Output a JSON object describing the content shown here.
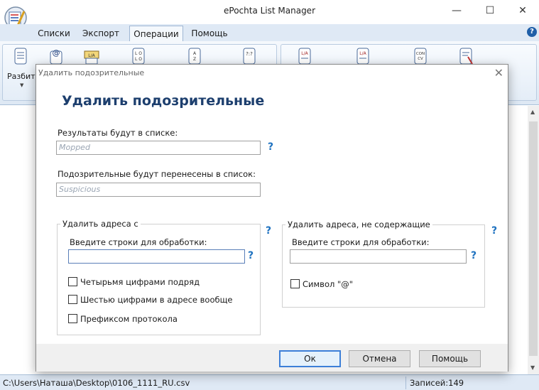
{
  "window": {
    "title": "ePochta List Manager",
    "controls": {
      "minimize": "—",
      "maximize": "☐",
      "close": "✕"
    }
  },
  "menu": {
    "tabs": [
      {
        "label": "Списки",
        "active": false
      },
      {
        "label": "Экспорт",
        "active": false
      },
      {
        "label": "Операции",
        "active": true
      },
      {
        "label": "Помощь",
        "active": false
      }
    ],
    "help_icon": "?"
  },
  "ribbon": {
    "first_label": "Разбить",
    "icons": [
      "split-icon",
      "at-icon",
      "list-icon",
      "sort-icon",
      "sort-az-icon",
      "question-list-icon",
      "merge-icon",
      "intersect-icon",
      "convert-icon",
      "filter-icon"
    ]
  },
  "status": {
    "path": "C:\\Users\\Наташа\\Desktop\\0106_1111_RU.csv",
    "records": "Записей:149"
  },
  "dialog": {
    "title": "Удалить подозрительные",
    "heading": "Удалить подозрительные",
    "close": "✕",
    "results_label": "Результаты будут в списке:",
    "results_value": "Mopped",
    "suspicious_label": "Подозрительные будут перенесены в список:",
    "suspicious_value": "Suspicious",
    "help_mark": "?",
    "left_group": {
      "legend": "Удалить адреса с",
      "input_label": "Введите строки для обработки:",
      "input_value": "",
      "options": [
        {
          "label": "Четырьмя цифрами подряд",
          "checked": false
        },
        {
          "label": "Шестью цифрами в адресе вообще",
          "checked": false
        },
        {
          "label": "Префиксом протокола",
          "checked": false
        }
      ]
    },
    "right_group": {
      "legend": "Удалить адреса, не содержащие",
      "input_label": "Введите строки для обработки:",
      "input_value": "",
      "options": [
        {
          "label": "Символ \"@\"",
          "checked": false
        }
      ]
    },
    "buttons": {
      "ok": "Ок",
      "cancel": "Отмена",
      "help": "Помощь"
    }
  },
  "colors": {
    "heading": "#1d3f6e",
    "help_mark": "#1f72c0",
    "menubar": "#dfe9f5",
    "default_button_border": "#3c7fd8"
  }
}
